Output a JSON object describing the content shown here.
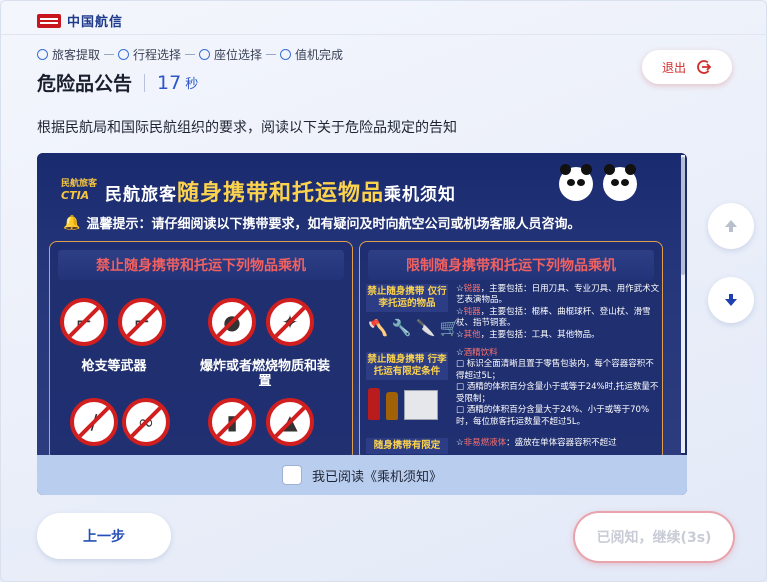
{
  "app": {
    "logo_text": "中国航信",
    "logo_mark_text": "TravelSky"
  },
  "steps": [
    {
      "label": "旅客提取"
    },
    {
      "label": "行程选择"
    },
    {
      "label": "座位选择"
    },
    {
      "label": "值机完成"
    }
  ],
  "header": {
    "title": "危险品公告",
    "countdown": "17",
    "countdown_unit": "秒",
    "exit_label": "退出"
  },
  "intro": "根据民航局和国际民航组织的要求，阅读以下关于危险品规定的告知",
  "poster": {
    "org_cn": "民航旅客",
    "org_logo_text": "民航旅客",
    "org_logo_abbr": "CTIA",
    "title_prefix": "民航旅客",
    "title_main": "随身携带和托运物品",
    "title_suffix": "乘机须知",
    "warning": "温馨提示：请仔细阅读以下携带要求，如有疑问及时向航空公司或机场客服人员咨询。",
    "left_panel": {
      "heading": "禁止随身携带和托运下列物品乘机",
      "items": [
        "枪支等武器",
        "爆炸或者燃烧物质和装置"
      ]
    },
    "right_panel": {
      "heading": "限制随身携带和托运下列物品乘机",
      "sub1": "禁止随身携带 仅行李托运的物品",
      "rule1_a_tag": "锐器",
      "rule1_a": "，主要包括：日用刀具、专业刀具、用作武术文艺表演物品。",
      "rule1_b_tag": "钝器",
      "rule1_b": "，主要包括：棍棒、曲棍球杆、登山杖、滑雪杖、指节铜套。",
      "rule1_c_tag": "其他",
      "rule1_c": "，主要包括：工具、其他物品。",
      "sub2": "禁止随身携带 行李托运有限定条件",
      "rule2_tag": "酒精饮料",
      "rule2_a": "□ 标识全面清晰且置于零售包装内，每个容器容积不得超过5L；",
      "rule2_b": "□ 酒精的体积百分含量小于或等于24%时,托运数量不受限制；",
      "rule2_c": "□ 酒精的体积百分含量大于24%、小于或等于70%时，每位旅客托运数量不超过5L。",
      "sub3": "随身携带有限定",
      "rule3_tag": "非易燃液体",
      "rule3": "：盛放在单体容器容积不超过"
    }
  },
  "read_confirm": "我已阅读《乘机须知》",
  "footer": {
    "prev_label": "上一步",
    "next_label": "已阅知，继续(3s)"
  }
}
